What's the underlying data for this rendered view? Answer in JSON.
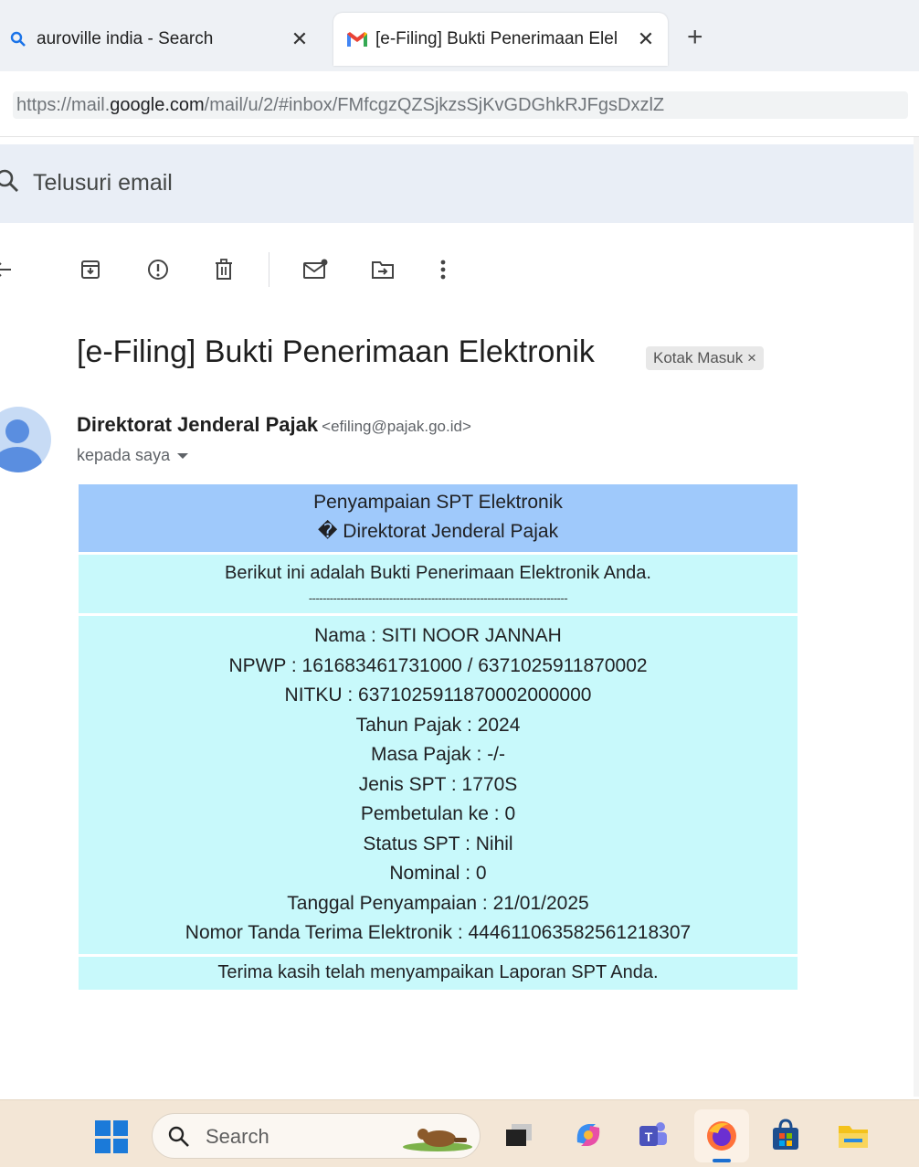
{
  "browser": {
    "tabs": [
      {
        "title": "auroville india - Search",
        "active": false,
        "icon": "search-icon"
      },
      {
        "title": "[e-Filing] Bukti Penerimaan Elel",
        "active": true,
        "icon": "gmail-icon"
      }
    ],
    "url": {
      "prefix": "https://mail.",
      "host": "google.com",
      "path": "/mail/u/2/#inbox/FMfcgzQZSjkzsSjKvGDGhkRJFgsDxzlZ"
    }
  },
  "gmail": {
    "search_placeholder": "Telusuri email",
    "toolbar_icons": [
      "back-icon",
      "archive-icon",
      "report-spam-icon",
      "delete-icon",
      "mark-unread-icon",
      "move-to-icon",
      "more-options-icon"
    ],
    "subject": "[e-Filing] Bukti Penerimaan Elektronik",
    "label_chip": "Kotak Masuk ×",
    "sender_name": "Direktorat Jenderal Pajak",
    "sender_email": "<efiling@pajak.go.id>",
    "recipient": "kepada saya"
  },
  "receipt": {
    "header_line1": "Penyampaian SPT Elektronik",
    "header_line2": "� Direktorat Jenderal Pajak",
    "intro": "Berikut ini adalah Bukti Penerimaan Elektronik Anda.",
    "divider": "--------------------------------------------------------------------------",
    "fields": [
      "Nama : SITI NOOR JANNAH",
      "NPWP : 161683461731000 / 6371025911870002",
      "NITKU : 6371025911870002000000",
      "Tahun Pajak : 2024",
      "Masa Pajak : -/-",
      "Jenis SPT : 1770S",
      "Pembetulan ke : 0",
      "Status SPT : Nihil",
      "Nominal : 0",
      "Tanggal Penyampaian : 21/01/2025",
      "Nomor Tanda Terima Elektronik : 444611063582561218307"
    ],
    "footer": "Terima kasih telah menyampaikan Laporan SPT Anda."
  },
  "taskbar": {
    "search_text": "Search",
    "apps": [
      "start-icon",
      "task-view-icon",
      "copilot-icon",
      "teams-icon",
      "firefox-icon",
      "store-icon",
      "file-explorer-icon"
    ],
    "colors": {
      "accent": "#1b7ad9",
      "header_blue": "#9fc9fb",
      "body_cyan": "#c8f9fb"
    }
  }
}
